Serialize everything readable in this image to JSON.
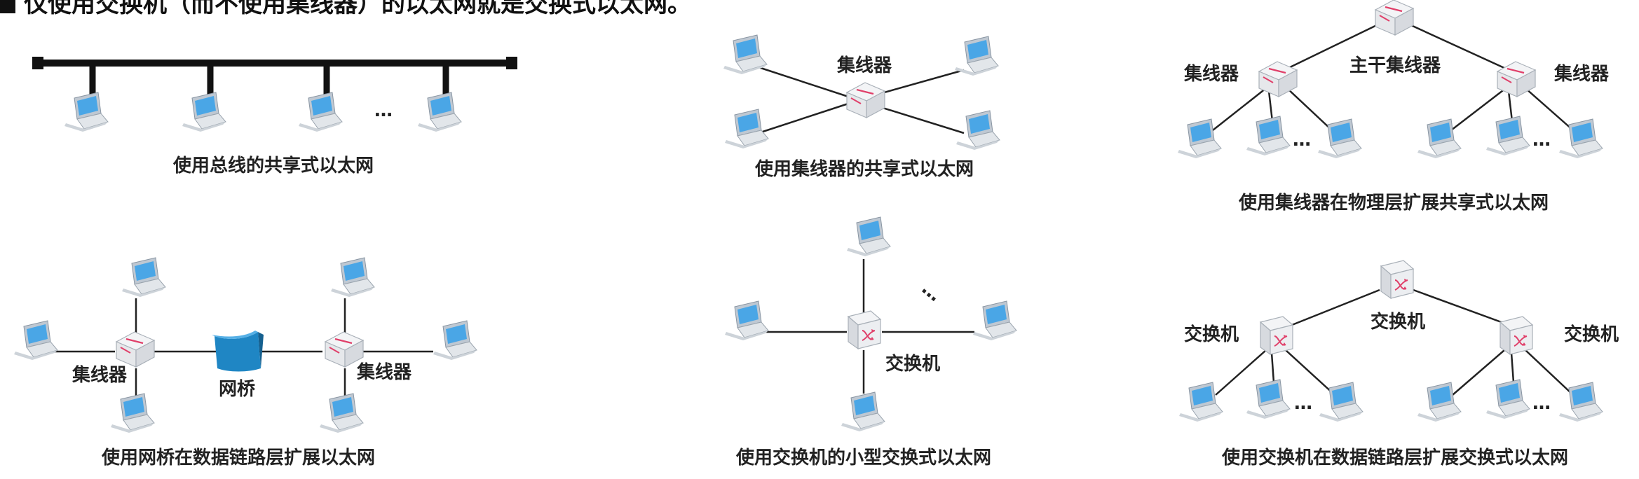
{
  "heading": "仅使用交换机（而不使用集线器）的以太网就是交换式以太网。",
  "labels": {
    "hub": "集线器",
    "trunk_hub": "主干集线器",
    "switch": "交换机",
    "bridge": "网桥",
    "ellipsis": "…"
  },
  "captions": {
    "bus": "使用总线的共享式以太网",
    "hub_shared": "使用集线器的共享式以太网",
    "hub_extend": "使用集线器在物理层扩展共享式以太网",
    "bridge_extend": "使用网桥在数据链路层扩展以太网",
    "small_switch": "使用交换机的小型交换式以太网",
    "switch_extend": "使用交换机在数据链路层扩展交换式以太网"
  },
  "colors": {
    "laptop_screen": "#4aa6e6",
    "device_mark": "#e0406a",
    "bridge": "#1f86c4"
  }
}
